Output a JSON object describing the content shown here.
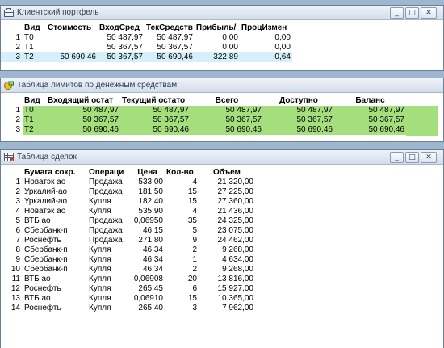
{
  "colors": {
    "title_bg": "#dde5ef",
    "highlight_row": "#d6f0fb",
    "limits_green": "#a4de7d",
    "desktop": "#9fb6cf"
  },
  "window_buttons": {
    "minimize": "_",
    "maximize": "□",
    "close": "✕"
  },
  "portfolio": {
    "title": "Клиентский портфель",
    "icon": "portfolio-icon",
    "columns": [
      "Вид",
      "Стоимость",
      "ВходСред",
      "ТекСредств",
      "Прибыль/",
      "ПроцИзмен"
    ],
    "rows": [
      {
        "n": "1",
        "vid": "T0",
        "cost": "",
        "in": "50 487,97",
        "cur": "50 487,97",
        "profit": "0,00",
        "pct": "0,00"
      },
      {
        "n": "2",
        "vid": "T1",
        "cost": "",
        "in": "50 367,57",
        "cur": "50 367,57",
        "profit": "0,00",
        "pct": "0,00"
      },
      {
        "n": "3",
        "vid": "T2",
        "cost": "50 690,46",
        "in": "50 367,57",
        "cur": "50 690,46",
        "profit": "322,89",
        "pct": "0,64"
      }
    ]
  },
  "limits": {
    "title": "Таблица лимитов по денежным средствам",
    "icon": "money-limits-icon",
    "columns": [
      "Вид",
      "Входящий остат",
      "Текущий остато",
      "Всего",
      "Доступно",
      "Баланс"
    ],
    "rows": [
      {
        "n": "1",
        "vid": "T0",
        "in": "50 487,97",
        "cur": "50 487,97",
        "total": "50 487,97",
        "avail": "50 487,97",
        "bal": "50 487,97"
      },
      {
        "n": "2",
        "vid": "T1",
        "in": "50 367,57",
        "cur": "50 367,57",
        "total": "50 367,57",
        "avail": "50 367,57",
        "bal": "50 367,57"
      },
      {
        "n": "3",
        "vid": "T2",
        "in": "50 690,46",
        "cur": "50 690,46",
        "total": "50 690,46",
        "avail": "50 690,46",
        "bal": "50 690,46"
      }
    ]
  },
  "deals": {
    "title": "Таблица сделок",
    "icon": "deals-table-icon",
    "columns": [
      "Бумага сокр.",
      "Операци",
      "Цена",
      "Кол-во",
      "Объем"
    ],
    "rows": [
      {
        "n": "1",
        "sec": "Новатэк ао",
        "op": "Продажа",
        "price": "533,00",
        "qty": "4",
        "vol": "21 320,00"
      },
      {
        "n": "2",
        "sec": "Уркалий-ао",
        "op": "Продажа",
        "price": "181,50",
        "qty": "15",
        "vol": "27 225,00"
      },
      {
        "n": "3",
        "sec": "Уркалий-ао",
        "op": "Купля",
        "price": "182,40",
        "qty": "15",
        "vol": "27 360,00"
      },
      {
        "n": "4",
        "sec": "Новатэк ао",
        "op": "Купля",
        "price": "535,90",
        "qty": "4",
        "vol": "21 436,00"
      },
      {
        "n": "5",
        "sec": "ВТБ ао",
        "op": "Продажа",
        "price": "0,06950",
        "qty": "35",
        "vol": "24 325,00"
      },
      {
        "n": "6",
        "sec": "Сбербанк-п",
        "op": "Продажа",
        "price": "46,15",
        "qty": "5",
        "vol": "23 075,00"
      },
      {
        "n": "7",
        "sec": "Роснефть",
        "op": "Продажа",
        "price": "271,80",
        "qty": "9",
        "vol": "24 462,00"
      },
      {
        "n": "8",
        "sec": "Сбербанк-п",
        "op": "Купля",
        "price": "46,34",
        "qty": "2",
        "vol": "9 268,00"
      },
      {
        "n": "9",
        "sec": "Сбербанк-п",
        "op": "Купля",
        "price": "46,34",
        "qty": "1",
        "vol": "4 634,00"
      },
      {
        "n": "10",
        "sec": "Сбербанк-п",
        "op": "Купля",
        "price": "46,34",
        "qty": "2",
        "vol": "9 268,00"
      },
      {
        "n": "11",
        "sec": "ВТБ ао",
        "op": "Купля",
        "price": "0,06908",
        "qty": "20",
        "vol": "13 816,00"
      },
      {
        "n": "12",
        "sec": "Роснефть",
        "op": "Купля",
        "price": "265,45",
        "qty": "6",
        "vol": "15 927,00"
      },
      {
        "n": "13",
        "sec": "ВТБ ао",
        "op": "Купля",
        "price": "0,06910",
        "qty": "15",
        "vol": "10 365,00"
      },
      {
        "n": "14",
        "sec": "Роснефть",
        "op": "Купля",
        "price": "265,40",
        "qty": "3",
        "vol": "7 962,00"
      }
    ]
  }
}
